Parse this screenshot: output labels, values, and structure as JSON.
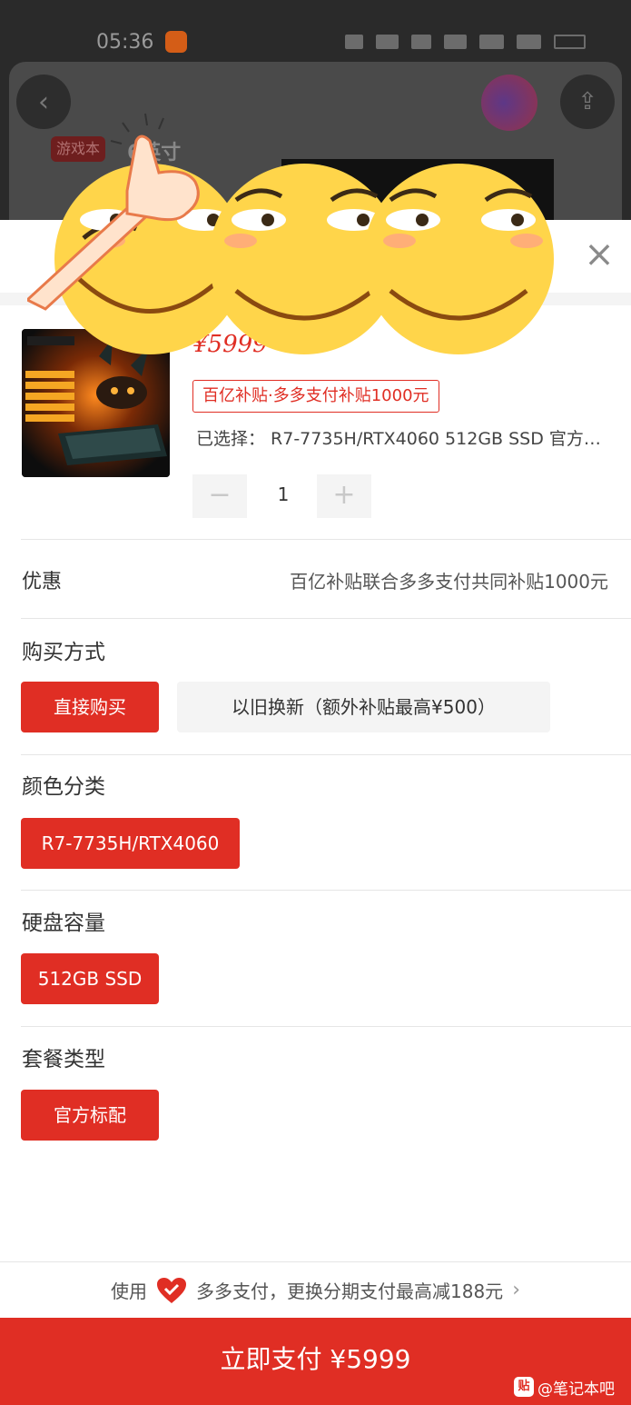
{
  "status_bar": {
    "time": "05:36"
  },
  "background": {
    "tag": "游戏本",
    "title": "6英寸"
  },
  "product": {
    "price": "¥5999",
    "subsidy_badge": "百亿补贴·多多支付补贴1000元",
    "selected": "已选择： R7-7735H/RTX4060 512GB SSD 官方标配",
    "quantity": "1",
    "thumb_brand": "机械革命",
    "thumb_lines": [
      "锐龙7 7735H",
      "140W满功耗4060",
      "2.5K/165Hz",
      "16G双通道内存",
      "独显直连"
    ]
  },
  "discount": {
    "label": "优惠",
    "value": "百亿补贴联合多多支付共同补贴1000元"
  },
  "sections": {
    "purchase": {
      "title": "购买方式",
      "options": [
        "直接购买",
        "以旧换新（额外补贴最高¥500）"
      ]
    },
    "color": {
      "title": "颜色分类",
      "options": [
        "R7-7735H/RTX4060"
      ]
    },
    "storage": {
      "title": "硬盘容量",
      "options": [
        "512GB SSD"
      ]
    },
    "package": {
      "title": "套餐类型",
      "options": [
        "官方标配"
      ]
    }
  },
  "pay_hint": {
    "prefix": "使用",
    "text": "多多支付，更换分期支付最高减188元"
  },
  "pay_button": {
    "label": "立即支付 ¥5999"
  },
  "watermark": {
    "logo": "贴",
    "text": "@笔记本吧"
  },
  "colors": {
    "accent": "#e02e24",
    "chip_bg": "#f4f4f4"
  }
}
